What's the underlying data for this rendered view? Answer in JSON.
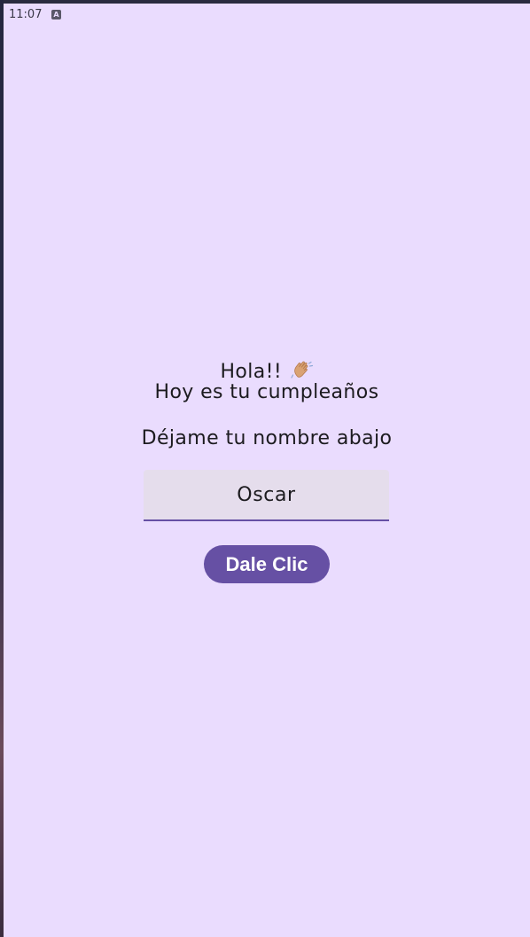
{
  "status_bar": {
    "time": "11:07",
    "notification_icon": "a-icon",
    "notification_glyph": "A"
  },
  "main": {
    "greeting": "Hola!!",
    "greeting_icon": "waving-hand-icon",
    "subline": "Hoy es tu cumpleaños",
    "prompt": "Déjame tu nombre abajo",
    "name_input": {
      "value": "Oscar",
      "placeholder": ""
    },
    "button_label": "Dale Clic"
  },
  "colors": {
    "background": "#eadcfe",
    "primary": "#6650a4",
    "field_background": "#e5ddec",
    "text": "#1c1b1f"
  }
}
